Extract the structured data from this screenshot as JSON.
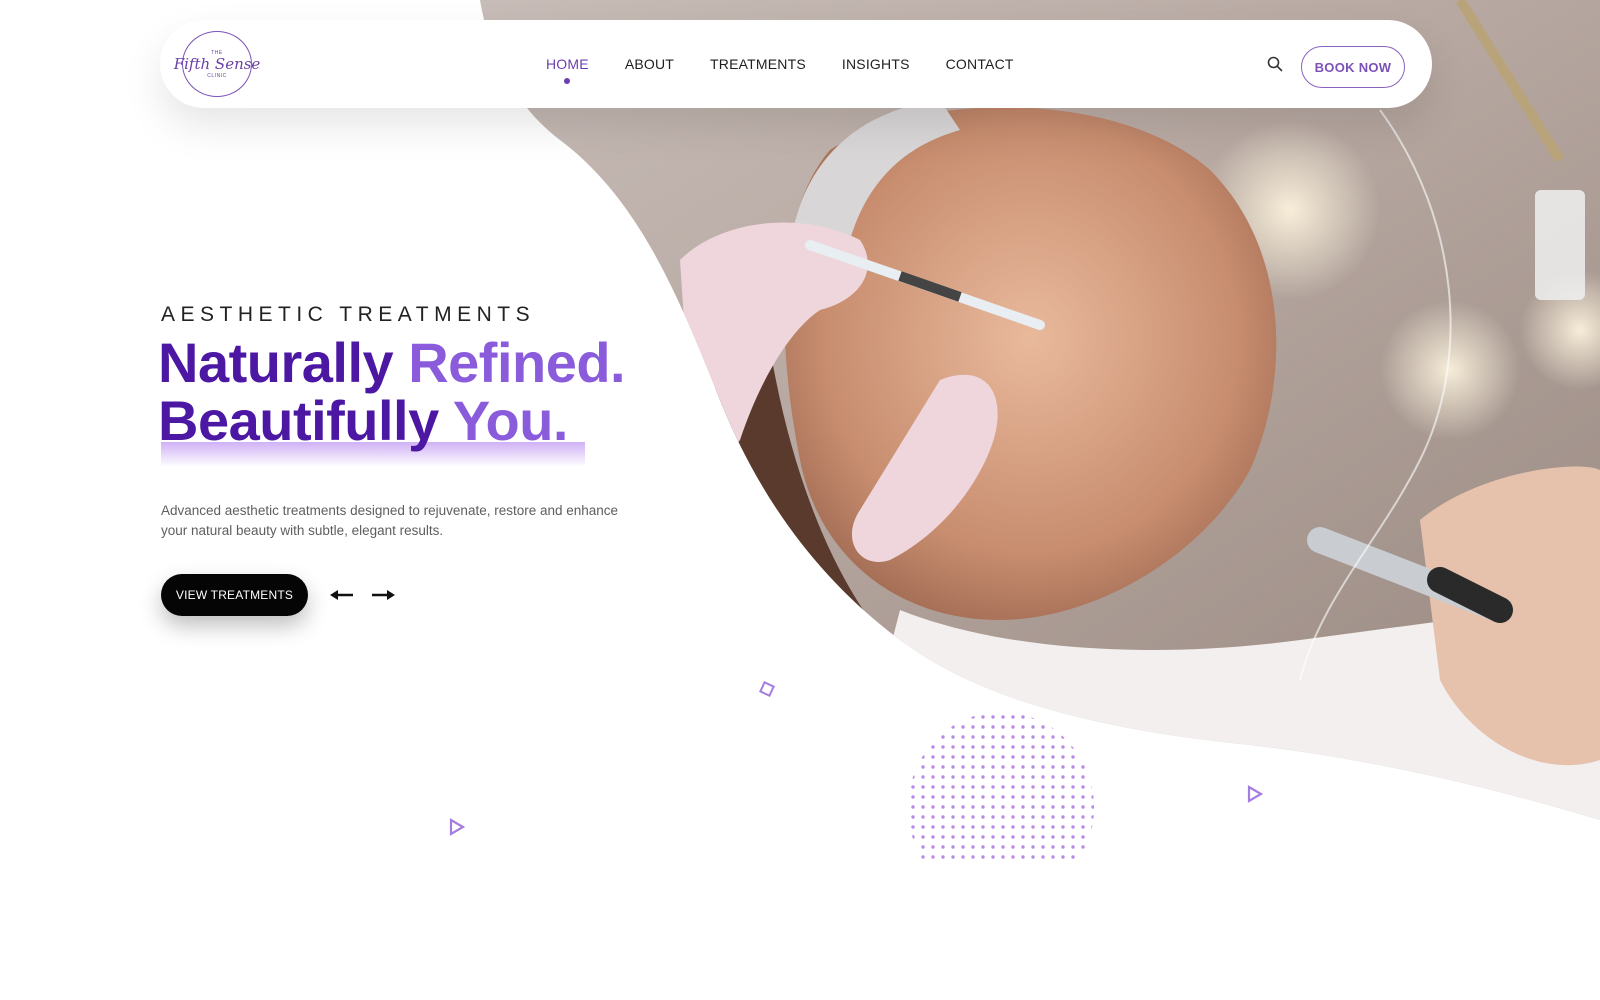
{
  "brand": {
    "logo_top": "THE",
    "logo_name": "Fifth Sense",
    "logo_bottom": "CLINIC"
  },
  "nav": {
    "items": [
      {
        "label": "HOME",
        "active": true
      },
      {
        "label": "ABOUT",
        "active": false
      },
      {
        "label": "TREATMENTS",
        "active": false
      },
      {
        "label": "INSIGHTS",
        "active": false
      },
      {
        "label": "CONTACT",
        "active": false
      }
    ],
    "search_icon": "search-icon",
    "book_label": "BOOK NOW"
  },
  "hero": {
    "eyebrow": "AESTHETIC TREATMENTS",
    "headline_line1_a": "Naturally",
    "headline_line1_b": "Refined.",
    "headline_line2_a": "Beautifully",
    "headline_line2_b": "You.",
    "description": "Advanced aesthetic treatments designed to rejuvenate, restore and enhance your natural beauty with subtle, elegant results.",
    "cta_label": "VIEW TREATMENTS",
    "prev_icon": "arrow-left-icon",
    "next_icon": "arrow-right-icon"
  },
  "colors": {
    "accent_dark": "#4c17a3",
    "accent_light": "#8a5cdc",
    "button": "#050505",
    "text": "#222222"
  }
}
